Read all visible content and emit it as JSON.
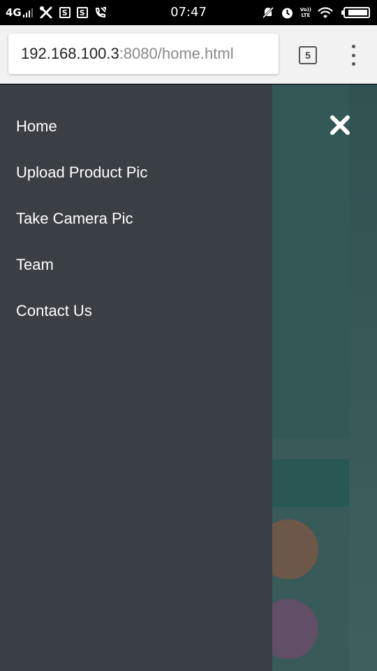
{
  "status_bar": {
    "network": "4G",
    "time": "07:47",
    "volte_top": "Vo))",
    "volte_bottom": "LTE",
    "sim_label": "S",
    "icons": [
      "signal-icon",
      "tools-icon",
      "sim-icon",
      "sim-icon",
      "missed-call-icon",
      "mute-icon",
      "alarm-icon",
      "volte-icon",
      "wifi-icon",
      "battery-icon"
    ],
    "battery_level": 0.9
  },
  "browser": {
    "url_host": "192.168.100.3",
    "url_path": ":8080/home.html",
    "tab_count": "5",
    "menu_icon": "more-vert-icon"
  },
  "drawer": {
    "items": [
      {
        "label": "Home"
      },
      {
        "label": "Upload Product Pic"
      },
      {
        "label": "Take Camera Pic"
      },
      {
        "label": "Team"
      },
      {
        "label": "Contact Us"
      }
    ],
    "close_icon": "close-icon",
    "background": "#393f45"
  },
  "page": {
    "background": "#3f6b67"
  }
}
